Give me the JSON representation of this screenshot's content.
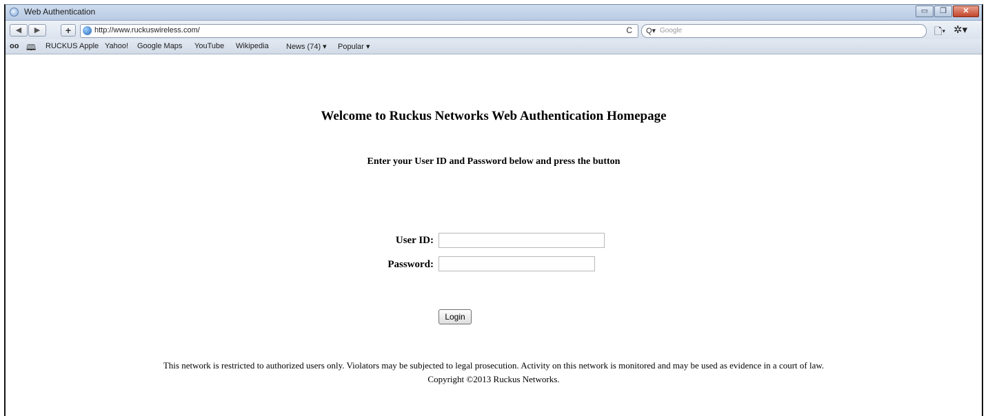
{
  "window": {
    "title": "Web Authentication",
    "controls": {
      "minimize": "▭",
      "maximize": "❐",
      "close": "✕"
    }
  },
  "navbar": {
    "back": "◀",
    "forward": "▶",
    "add": "+",
    "url": "http://www.ruckuswireless.com/",
    "reload": "C",
    "search_icon": "Q▾",
    "search_placeholder": "Google",
    "page_menu": "🗋▾",
    "gear_menu": "✲▾"
  },
  "bookmarks": {
    "reading_list_icon": "oo",
    "book_icon": "🕮",
    "items": [
      "RUCKUS",
      "Apple",
      "Yahoo!",
      "Google Maps",
      "YouTube",
      "Wikipedia",
      "News (74) ▾",
      "Popular ▾"
    ]
  },
  "page": {
    "welcome": "Welcome to Ruckus Networks Web Authentication Homepage",
    "instructions": "Enter your User ID and Password below and press the button",
    "user_id_label": "User ID:",
    "password_label": "Password:",
    "user_id_value": "",
    "password_value": "",
    "login_label": "Login",
    "disclaimer": "This network is restricted to authorized users only. Violators may be subjected to legal prosecution. Activity on this network is monitored and may be used as evidence in a court of law.",
    "copyright": "Copyright ©2013 Ruckus Networks."
  },
  "colors": {
    "titlebar": "#c5d5ea",
    "close_button": "#c2452b",
    "background": "#ffffff"
  }
}
